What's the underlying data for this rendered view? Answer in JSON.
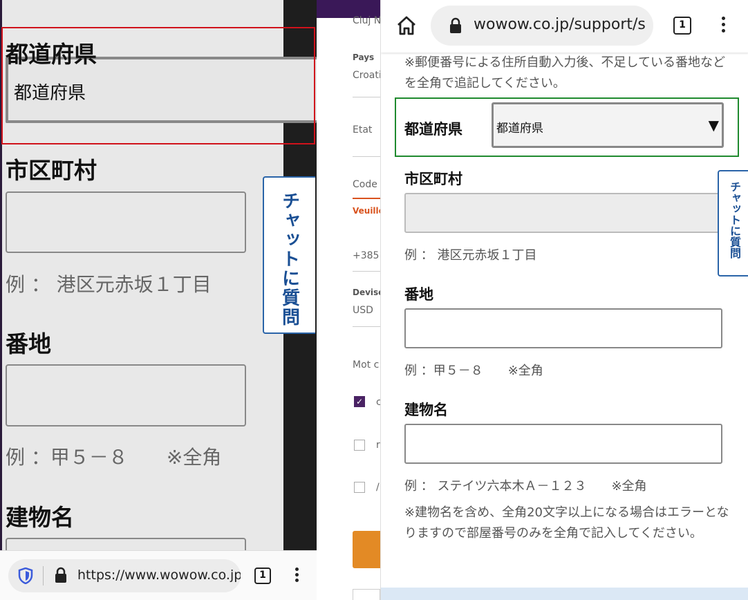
{
  "left": {
    "prefecture_label": "都道府県",
    "prefecture_select_value": "都道府県",
    "city_label": "市区町村",
    "city_hint": "例 ： 港区元赤坂１丁目",
    "banchi_label": "番地",
    "banchi_hint": "例 ：甲５－８　　※全角",
    "building_label": "建物名",
    "chat_tab": "チャットに質問",
    "url": "https://www.wowow.co.jp/s",
    "tab_count": "1",
    "focus_color": "#d0121b"
  },
  "middle": {
    "city_value": "Cluj N",
    "pays_label": "Pays",
    "pays_value": "Croati",
    "etat_label": "Etat",
    "code_label": "Code",
    "error_text": "Veuille",
    "phone_prefix": "+385",
    "devise_label": "Devise",
    "devise_value": "USD",
    "mot_label": "Mot c",
    "checkbox_1_text": "c",
    "checkbox_2_text": "r",
    "checkbox_3_text": "/",
    "accent_color": "#4a2364",
    "button_color": "#e38a25"
  },
  "right": {
    "url": "wowow.co.jp/support/s",
    "tab_count": "1",
    "top_note": "※郵便番号による住所自動入力後、不足している番地などを全角で追記してください。",
    "prefecture_label": "都道府県",
    "prefecture_select_value": "都道府県",
    "city_label": "市区町村",
    "city_hint": "例 ： 港区元赤坂１丁目",
    "banchi_label": "番地",
    "banchi_hint": "例 ：甲５－８　　※全角",
    "building_label": "建物名",
    "building_hint": "例 ： ステイツ六本木Ａ－１２３　　※全角",
    "building_note": "※建物名を含め、全角20文字以上になる場合はエラーとなりますので部屋番号のみを全角で記入してください。",
    "chat_tab": "チャットに質問",
    "focus_color": "#1f8a2e"
  }
}
